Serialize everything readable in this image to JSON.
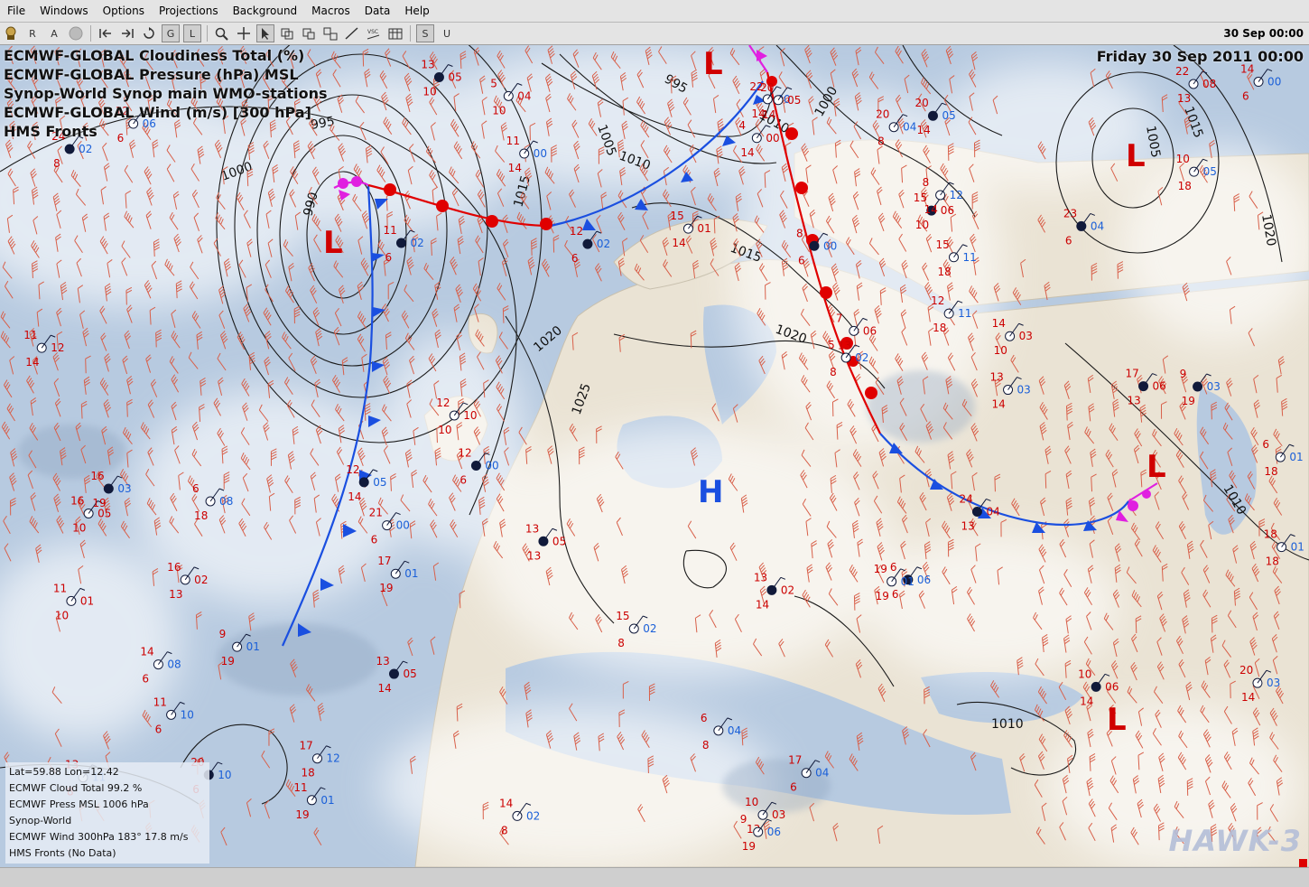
{
  "menu": [
    "File",
    "Windows",
    "Options",
    "Projections",
    "Background",
    "Macros",
    "Data",
    "Help"
  ],
  "toolbar": {
    "buttons": [
      "R",
      "A",
      "G",
      "L",
      "S",
      "U"
    ],
    "datetime": "30 Sep 00:00"
  },
  "map": {
    "layer_titles": [
      "ECMWF-GLOBAL Cloudiness Total (%)",
      "ECMWF-GLOBAL Pressure (hPa) MSL",
      "Synop-World Synop main WMO-stations",
      "ECMWF-GLOBAL Wind (m/s) [300 hPa]",
      "HMS Fronts"
    ],
    "date": "Friday 30 Sep 2011 00:00",
    "isobar_labels": [
      "1000",
      "995",
      "990",
      "1005",
      "1010",
      "995",
      "1015",
      "1010",
      "1015",
      "1020",
      "1025",
      "1020",
      "1000",
      "1015",
      "1005",
      "1020",
      "1010",
      "1010"
    ],
    "pressure_centres": [
      {
        "label": "L",
        "type": "low"
      },
      {
        "label": "L",
        "type": "low"
      },
      {
        "label": "L",
        "type": "low"
      },
      {
        "label": "L",
        "type": "low"
      },
      {
        "label": "L",
        "type": "low"
      },
      {
        "label": "H",
        "type": "high"
      }
    ],
    "station_values": [
      "16",
      "12",
      "12",
      "10",
      "17",
      "14",
      "13",
      "11",
      "20",
      "15",
      "18",
      "13",
      "22",
      "21",
      "20",
      "15",
      "16",
      "14",
      "12",
      "10",
      "22",
      "13",
      "11",
      "15",
      "13",
      "9",
      "14",
      "11",
      "17",
      "11",
      "7",
      "6",
      "5",
      "4",
      "9",
      "12",
      "13",
      "6",
      "8",
      "16",
      "12",
      "13",
      "11",
      "17",
      "8",
      "14",
      "15",
      "20",
      "24",
      "23",
      "24",
      "20",
      "19",
      "11",
      "5",
      "6",
      "20",
      "17",
      "12",
      "6",
      "10",
      "9",
      "11"
    ],
    "blue_codes": [
      "06",
      "11",
      "05",
      "03",
      "04",
      "02",
      "06",
      "01",
      "10",
      "02",
      "01",
      "03",
      "04",
      "00",
      "04",
      "03",
      "03",
      "00",
      "01",
      "05",
      "00",
      "00",
      "02",
      "02",
      "01",
      "06",
      "08",
      "01",
      "12",
      "00",
      "05",
      "06",
      "02",
      "00",
      "01",
      "02",
      "03",
      "08",
      "12",
      "04",
      "06",
      "11",
      "29",
      "01",
      "00"
    ],
    "red_codes": [
      "05",
      "03",
      "02",
      "03",
      "04",
      "01",
      "05",
      "05",
      "06",
      "06",
      "04",
      "00",
      "08",
      "06",
      "05",
      "01",
      "06",
      "02",
      "10",
      "11",
      "12",
      "05"
    ]
  },
  "info_panel": {
    "latlon": "Lat=59.88 Lon=12.42",
    "cloud": "ECMWF Cloud Total   99.2 %",
    "press": "ECMWF Press MSL   1006 hPa",
    "synop": "Synop-World",
    "wind": "ECMWF Wind 300hPa   183° 17.8 m/s",
    "fronts": "HMS Fronts   (No Data)"
  },
  "watermark": "HAWK-3",
  "colors": {
    "cold_front": "#1a4fe0",
    "warm_front": "#e00000",
    "occluded": "#e020e0",
    "low": "#d00000",
    "high": "#1a4fe0",
    "barb": "#d8604a"
  }
}
